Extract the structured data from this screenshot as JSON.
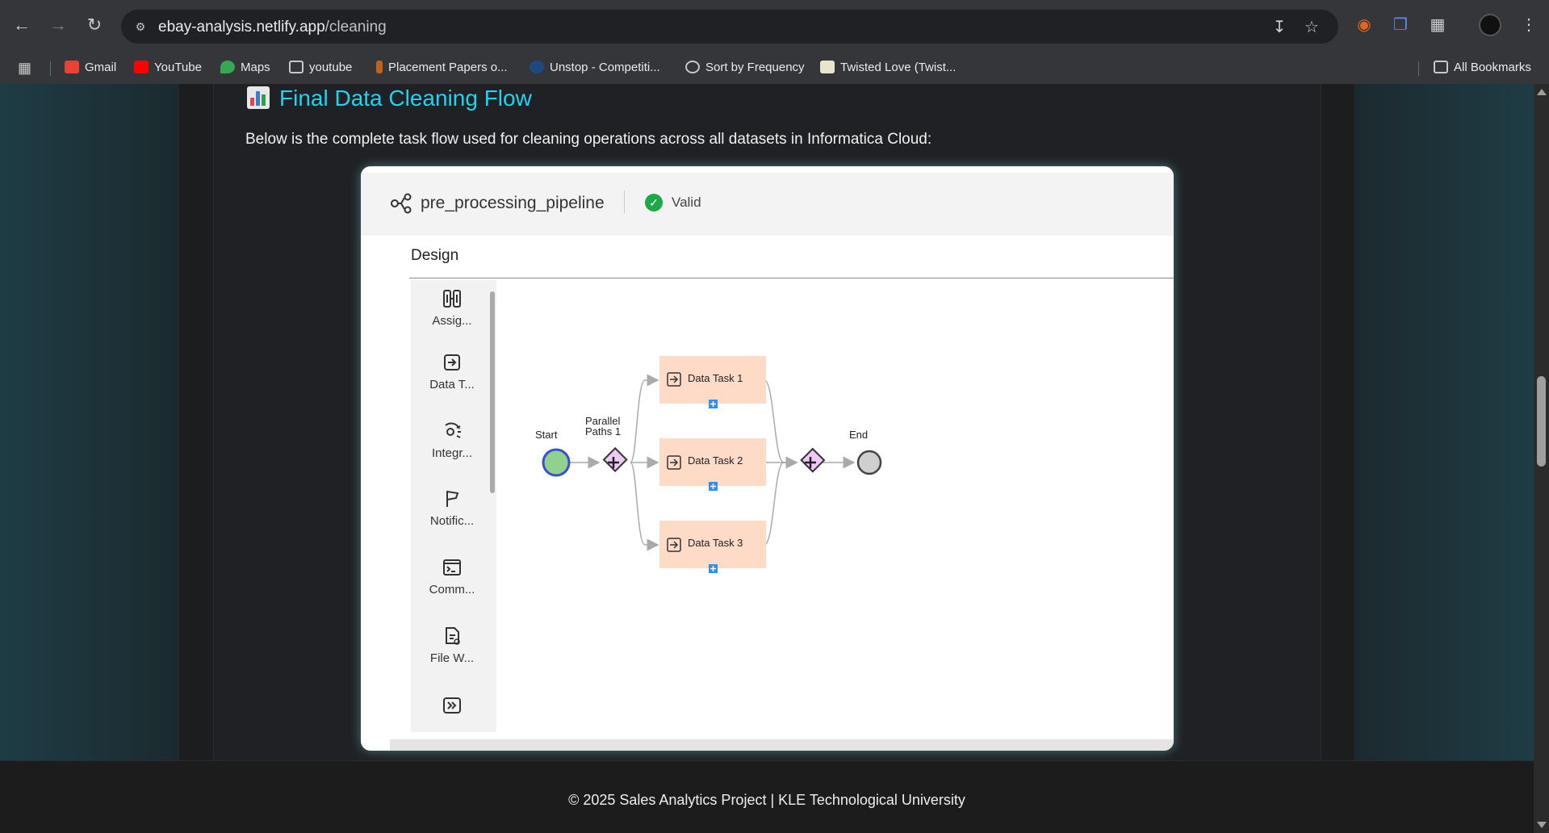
{
  "browser": {
    "url_domain": "ebay-analysis.netlify.app",
    "url_path": "/cleaning",
    "bookmarks": [
      {
        "label": "Gmail",
        "icon": "gmail-icon",
        "color": "#ea4335"
      },
      {
        "label": "YouTube",
        "icon": "youtube-icon",
        "color": "#ff0000"
      },
      {
        "label": "Maps",
        "icon": "maps-icon",
        "color": "#34a853"
      },
      {
        "label": "youtube",
        "icon": "folder-icon",
        "color": "#c8c8c8"
      },
      {
        "label": "Placement Papers o...",
        "icon": "placement-icon",
        "color": "#c0611c"
      },
      {
        "label": "Unstop - Competiti...",
        "icon": "unstop-icon",
        "color": "#1c4980"
      },
      {
        "label": "Sort by Frequency",
        "icon": "globe-icon",
        "color": "#c8c8c8"
      },
      {
        "label": "Twisted Love (Twist...",
        "icon": "goodreads-icon",
        "color": "#e9e5cd"
      }
    ],
    "all_bookmarks": "All Bookmarks"
  },
  "page": {
    "heading": "Final Data Cleaning Flow",
    "intro": "Below is the complete task flow used for cleaning operations across all datasets in Informatica Cloud:",
    "footer": "© 2025 Sales Analytics Project | KLE Technological University"
  },
  "pipeline": {
    "name": "pre_processing_pipeline",
    "status": "Valid",
    "design_label": "Design",
    "palette": [
      {
        "label": "Assig...",
        "icon": "assignment-icon"
      },
      {
        "label": "Data T...",
        "icon": "data-task-icon"
      },
      {
        "label": "Integr...",
        "icon": "integration-icon"
      },
      {
        "label": "Notific...",
        "icon": "notification-icon"
      },
      {
        "label": "Comm...",
        "icon": "command-icon"
      },
      {
        "label": "File W...",
        "icon": "file-watch-icon"
      }
    ],
    "nodes": {
      "start": "Start",
      "parallel_1": "Parallel",
      "parallel_2": "Paths 1",
      "end": "End",
      "tasks": [
        "Data Task 1",
        "Data Task 2",
        "Data Task 3"
      ]
    }
  }
}
